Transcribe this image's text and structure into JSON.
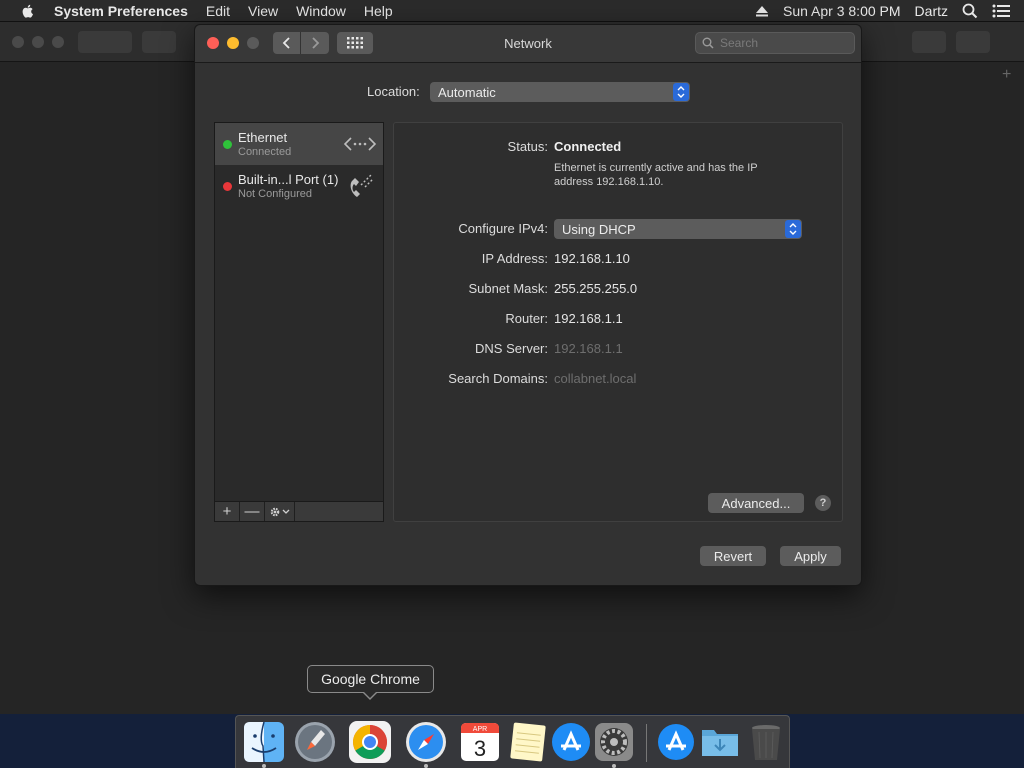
{
  "menubar": {
    "app_name": "System Preferences",
    "menus": [
      "Edit",
      "View",
      "Window",
      "Help"
    ],
    "datetime": "Sun Apr 3  8:00 PM",
    "user": "Dartz"
  },
  "window": {
    "title": "Network",
    "search_placeholder": "Search"
  },
  "location": {
    "label": "Location:",
    "value": "Automatic"
  },
  "services": [
    {
      "name": "Ethernet",
      "status": "Connected",
      "status_color": "#2fc23a",
      "icon": "ethernet-icon"
    },
    {
      "name": "Built-in...l Port (1)",
      "status": "Not Configured",
      "status_color": "#e8373a",
      "icon": "phone-modem-icon"
    }
  ],
  "service_toolbar": {
    "add": "+",
    "remove": "—"
  },
  "detail": {
    "status_label": "Status:",
    "status_value": "Connected",
    "status_desc": "Ethernet is currently active and has the IP address 192.168.1.10.",
    "configure_label": "Configure IPv4:",
    "configure_value": "Using DHCP",
    "ip_label": "IP Address:",
    "ip_value": "192.168.1.10",
    "subnet_label": "Subnet Mask:",
    "subnet_value": "255.255.255.0",
    "router_label": "Router:",
    "router_value": "192.168.1.1",
    "dns_label": "DNS Server:",
    "dns_value": "192.168.1.1",
    "domains_label": "Search Domains:",
    "domains_value": "collabnet.local",
    "advanced_button": "Advanced...",
    "help_button": "?"
  },
  "footer": {
    "revert_button": "Revert",
    "apply_button": "Apply"
  },
  "dock": {
    "tooltip": "Google Chrome",
    "calendar_month": "APR",
    "calendar_day": "3"
  }
}
